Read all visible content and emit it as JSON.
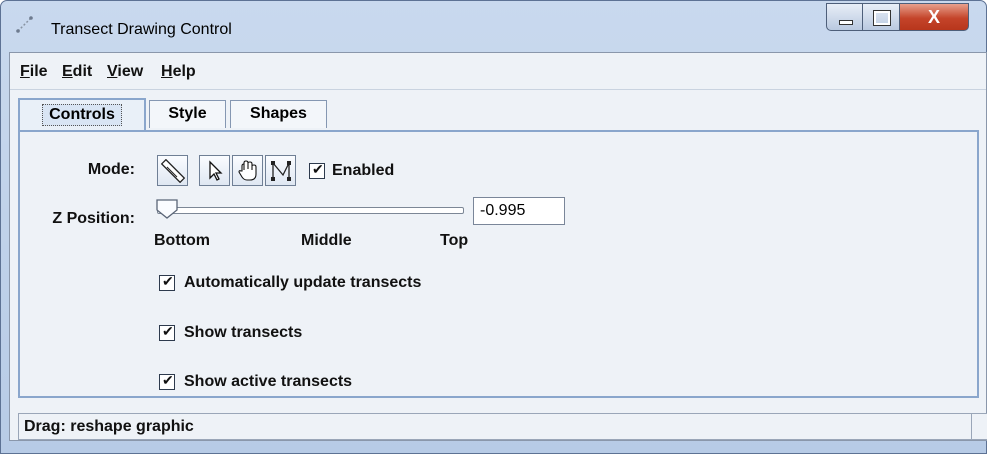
{
  "window": {
    "title": "Transect Drawing Control"
  },
  "menu": [
    {
      "mnemonic": "F",
      "rest": "ile"
    },
    {
      "mnemonic": "E",
      "rest": "dit"
    },
    {
      "mnemonic": "V",
      "rest": "iew"
    },
    {
      "mnemonic": "H",
      "rest": "elp"
    }
  ],
  "tabs": {
    "controls": "Controls",
    "style": "Style",
    "shapes": "Shapes",
    "selected": "Controls"
  },
  "controls": {
    "mode_label": "Mode:",
    "mode_buttons": [
      "draw-line-icon",
      "pointer-icon",
      "hand-icon",
      "reshape-icon"
    ],
    "enabled_label": "Enabled",
    "enabled_checked": true,
    "z_label": "Z Position:",
    "z_value": "-0.995",
    "z_slider_level": 0.0,
    "ticks": {
      "bottom": "Bottom",
      "middle": "Middle",
      "top": "Top"
    },
    "auto_update_label": "Automatically update transects",
    "auto_update_checked": true,
    "show_transects_label": "Show transects",
    "show_transects_checked": true,
    "show_active_label": "Show active transects",
    "show_active_checked": true
  },
  "status": {
    "text": "Drag: reshape graphic"
  },
  "colors": {
    "frame": "#b7cbe6",
    "panel": "#eef2f7",
    "accent": "#8aa6cc",
    "close": "#c4442a"
  }
}
